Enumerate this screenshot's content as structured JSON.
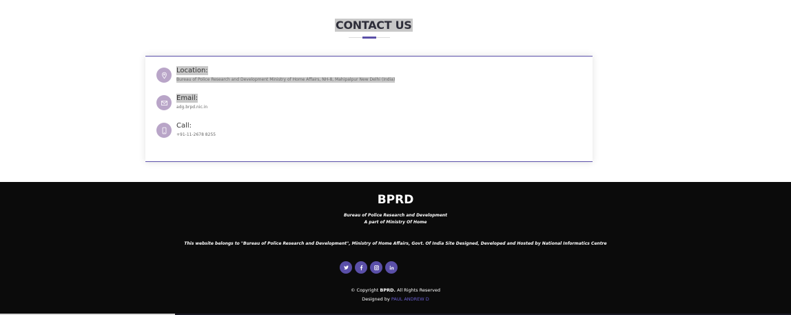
{
  "contact": {
    "title": "CONTACT US",
    "items": [
      {
        "icon": "map-pin-icon",
        "label": "Location:",
        "value": "Bureau of Police Research and Development Ministry of Home Affairs, NH-8, Mahipalpur New Delhi (India)"
      },
      {
        "icon": "envelope-icon",
        "label": "Email:",
        "value": "adg.brpd.nic.in"
      },
      {
        "icon": "mobile-phone-icon",
        "label": "Call:",
        "value": "+91-11-2678 8255"
      }
    ]
  },
  "footer": {
    "brand": "BPRD",
    "org_name": "Bureau of Police Research and Development",
    "org_sub": "A part of Ministry Of Home",
    "disclaimer": "This website belongs to \"Bureau of Police Research and Development\", Ministry of Home Affairs, Govt. Of India Site Designed, Developed and Hosted by National Informatics Centre",
    "social": [
      "twitter-icon",
      "facebook-icon",
      "instagram-icon",
      "linkedin-icon"
    ],
    "copyright_prefix": "© Copyright",
    "copyright_brand": "BPRD.",
    "copyright_suffix": "All Rights Reserved",
    "designed_by_prefix": "Designed by",
    "designed_by_name": "PAUL ANDREW D"
  },
  "colors": {
    "accent": "#5a4fa8",
    "icon_circle": "#b9a5c8",
    "footer_bg": "#0b0b0b"
  }
}
